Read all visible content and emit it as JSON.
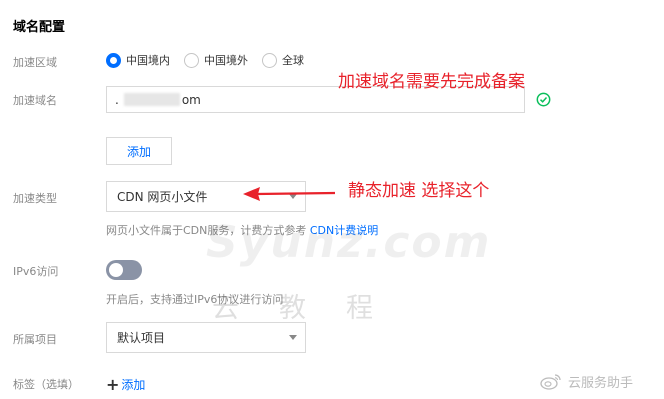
{
  "section_title": "域名配置",
  "labels": {
    "region": "加速区域",
    "domain": "加速域名",
    "type": "加速类型",
    "ipv6": "IPv6访问",
    "project": "所属项目",
    "tags": "标签（选填）"
  },
  "region_options": [
    {
      "label": "中国境内",
      "selected": true
    },
    {
      "label": "中国境外",
      "selected": false
    },
    {
      "label": "全球",
      "selected": false
    }
  ],
  "domain_input": {
    "prefix": ".",
    "suffix": "om"
  },
  "add_button_label": "添加",
  "type_select": {
    "value": "CDN 网页小文件"
  },
  "type_help": {
    "text": "网页小文件属于CDN服务，计费方式参考 ",
    "link": "CDN计费说明"
  },
  "ipv6": {
    "enabled": false,
    "help": "开启后，支持通过IPv6协议进行访问"
  },
  "project_select": {
    "value": "默认项目"
  },
  "add_tag_label": "添加",
  "annotations": {
    "domain_note": "加速域名需要先完成备案",
    "type_note": "静态加速 选择这个"
  },
  "watermark": {
    "latin": "Syunz.com",
    "cn": "云教程"
  },
  "weibo_mark": "云服务助手",
  "colors": {
    "accent": "#006eff",
    "annotation": "#e8222b",
    "success": "#0abf5b"
  }
}
